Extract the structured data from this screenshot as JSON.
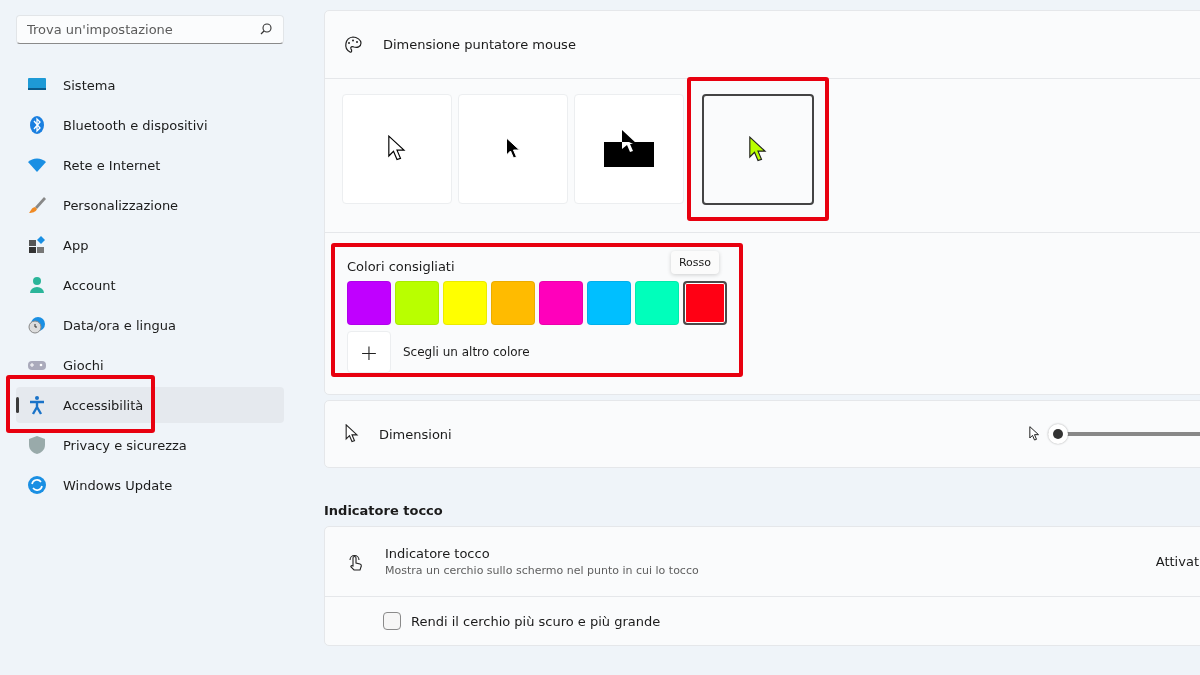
{
  "search": {
    "placeholder": "Trova un'impostazione"
  },
  "nav": [
    {
      "label": "Sistema",
      "selected": false,
      "highlighted": false
    },
    {
      "label": "Bluetooth e dispositivi",
      "selected": false,
      "highlighted": false
    },
    {
      "label": "Rete e Internet",
      "selected": false,
      "highlighted": false
    },
    {
      "label": "Personalizzazione",
      "selected": false,
      "highlighted": false
    },
    {
      "label": "App",
      "selected": false,
      "highlighted": false
    },
    {
      "label": "Account",
      "selected": false,
      "highlighted": false
    },
    {
      "label": "Data/ora e lingua",
      "selected": false,
      "highlighted": false
    },
    {
      "label": "Giochi",
      "selected": false,
      "highlighted": false
    },
    {
      "label": "Accessibilità",
      "selected": true,
      "highlighted": true
    },
    {
      "label": "Privacy e sicurezza",
      "selected": false,
      "highlighted": false
    },
    {
      "label": "Windows Update",
      "selected": false,
      "highlighted": false
    }
  ],
  "pointer_card": {
    "title": "Dimensione puntatore mouse",
    "styles": [
      {
        "kind": "white",
        "selected": false,
        "highlighted": false
      },
      {
        "kind": "black",
        "selected": false,
        "highlighted": false
      },
      {
        "kind": "inverted",
        "selected": false,
        "highlighted": false
      },
      {
        "kind": "custom",
        "selected": true,
        "highlighted": true
      }
    ],
    "colors_panel": {
      "title": "Colori consigliati",
      "highlighted": true,
      "tooltip": "Rosso",
      "swatches": [
        {
          "color": "#c000ff",
          "selected": false
        },
        {
          "color": "#b9ff00",
          "selected": false
        },
        {
          "color": "#ffff00",
          "selected": false
        },
        {
          "color": "#ffbb00",
          "selected": false
        },
        {
          "color": "#ff00bb",
          "selected": false
        },
        {
          "color": "#00bfff",
          "selected": false
        },
        {
          "color": "#00ffbb",
          "selected": false
        },
        {
          "color": "#ff0014",
          "selected": true
        }
      ],
      "add_button": "+",
      "add_label": "Scegli un altro colore"
    }
  },
  "size_card": {
    "title": "Dimensioni",
    "level": 0.0
  },
  "touch_section": {
    "heading": "Indicatore tocco",
    "title": "Indicatore tocco",
    "description": "Mostra un cerchio sullo schermo nel punto in cui lo tocco",
    "state": "Attivat",
    "checkbox": {
      "label": "Rendi il cerchio più scuro e più grande",
      "checked": false
    }
  }
}
